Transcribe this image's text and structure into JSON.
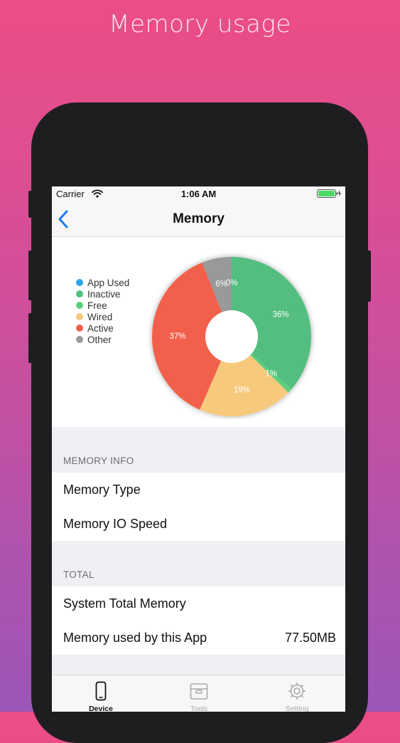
{
  "promo": {
    "title": "Memory usage"
  },
  "status_bar": {
    "carrier": "Carrier",
    "time": "1:06 AM"
  },
  "nav": {
    "title": "Memory"
  },
  "chart_data": {
    "type": "pie",
    "categories": [
      "App Used",
      "Inactive",
      "Free",
      "Wired",
      "Active",
      "Other"
    ],
    "values": [
      0,
      36,
      1,
      19,
      37,
      6
    ],
    "value_labels": [
      "0%",
      "36%",
      "1%",
      "19%",
      "37%",
      "6%"
    ],
    "colors": [
      "#2fa4e7",
      "#52be80",
      "#5ccf7e",
      "#f6c97d",
      "#f2604c",
      "#999999"
    ],
    "legend_position": "left"
  },
  "sections": {
    "memory_info": {
      "header": "MEMORY INFO",
      "rows": [
        {
          "label": "Memory Type",
          "value": ""
        },
        {
          "label": "Memory IO Speed",
          "value": ""
        }
      ]
    },
    "total": {
      "header": "TOTAL",
      "rows": [
        {
          "label": "System Total Memory",
          "value": ""
        },
        {
          "label": "Memory used by this App",
          "value": "77.50MB"
        }
      ]
    }
  },
  "tabs": [
    {
      "label": "Device",
      "icon": "phone-icon",
      "active": true
    },
    {
      "label": "Tools",
      "icon": "box-icon",
      "active": false
    },
    {
      "label": "Setting",
      "icon": "gear-icon",
      "active": false
    }
  ],
  "colors": {
    "accent": "#1a7cf2",
    "tab_active": "#111111",
    "tab_inactive": "#a9a9ae"
  }
}
